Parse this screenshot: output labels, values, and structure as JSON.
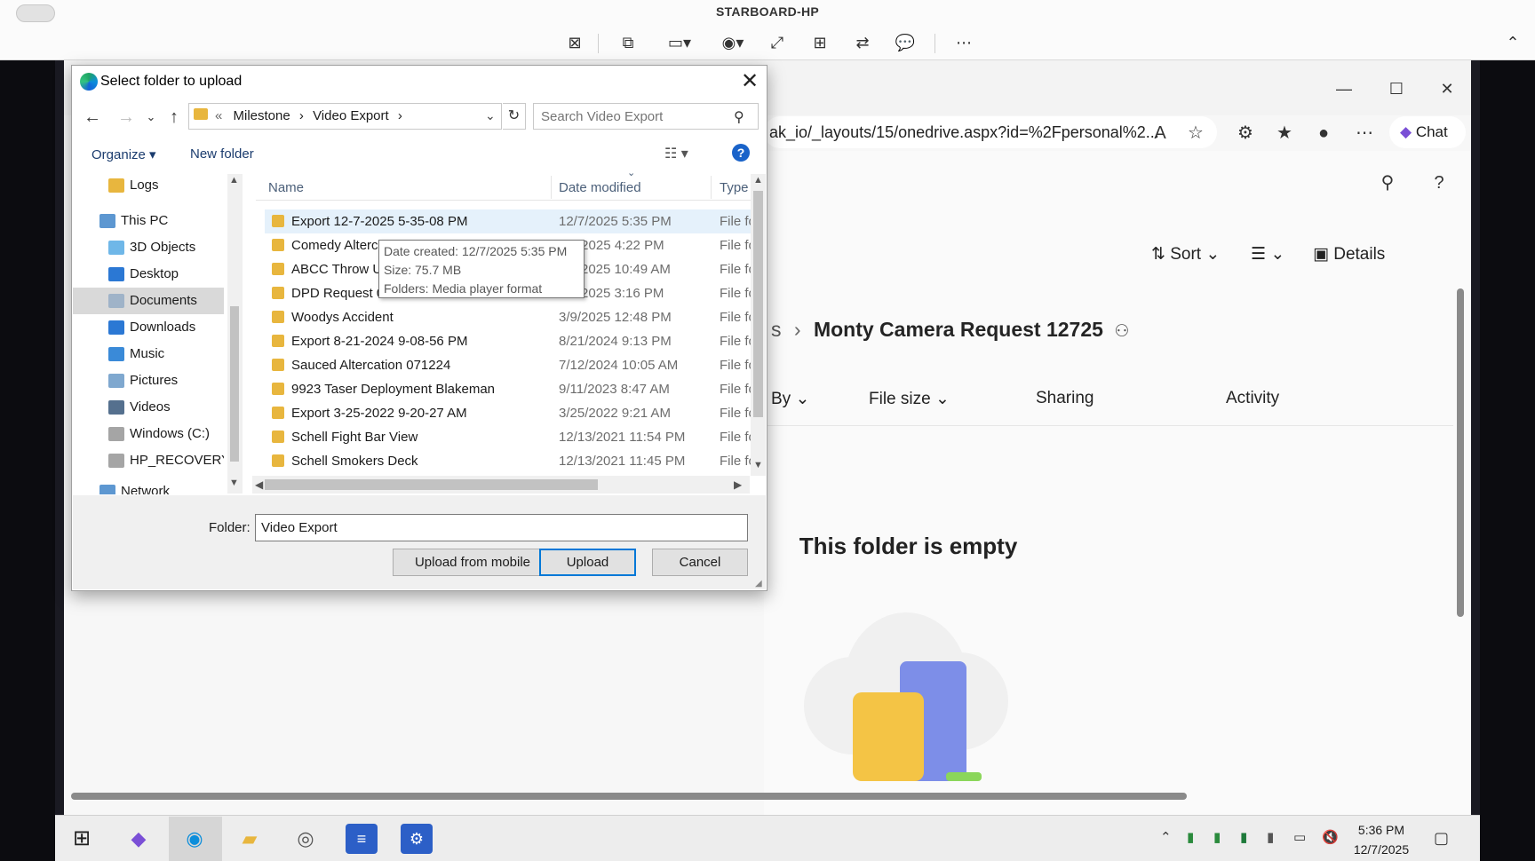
{
  "remote_session": {
    "title": "STARBOARD-HP",
    "toolbar_icons": [
      "disconnect-icon",
      "display-icon",
      "monitor-select-icon",
      "view-icon",
      "fullscreen-icon",
      "multi-monitor-icon",
      "switch-icon",
      "chat-icon",
      "more-icon",
      "collapse-icon"
    ]
  },
  "browser": {
    "address": "ak_io/_layouts/15/onedrive.aspx?id=%2Fpersonal%2...",
    "chat_label": "Chat",
    "window_controls": [
      "minimize-icon",
      "maximize-icon",
      "close-icon"
    ]
  },
  "onedrive": {
    "commands": {
      "sort": "Sort",
      "details": "Details"
    },
    "breadcrumb_prefix": "s",
    "breadcrumb_current": "Monty Camera Request 12725",
    "columns": {
      "by": "By",
      "file_size": "File size",
      "sharing": "Sharing",
      "activity": "Activity"
    },
    "empty_message": "This folder is empty"
  },
  "dialog": {
    "title": "Select folder to upload",
    "address_path": [
      "Milestone",
      "Video Export"
    ],
    "search_placeholder": "Search Video Export",
    "organize_label": "Organize",
    "new_folder_label": "New folder",
    "nav_items": [
      {
        "label": "Logs",
        "icon": "folder-icon"
      },
      {
        "label": "This PC",
        "icon": "pc-icon"
      },
      {
        "label": "3D Objects",
        "icon": "3d-objects-icon"
      },
      {
        "label": "Desktop",
        "icon": "desktop-icon"
      },
      {
        "label": "Documents",
        "icon": "documents-icon",
        "selected": true
      },
      {
        "label": "Downloads",
        "icon": "downloads-icon"
      },
      {
        "label": "Music",
        "icon": "music-icon"
      },
      {
        "label": "Pictures",
        "icon": "pictures-icon"
      },
      {
        "label": "Videos",
        "icon": "videos-icon"
      },
      {
        "label": "Windows (C:)",
        "icon": "drive-icon"
      },
      {
        "label": "HP_RECOVERY (I",
        "icon": "drive-icon"
      },
      {
        "label": "Network",
        "icon": "network-icon"
      }
    ],
    "columns": {
      "name": "Name",
      "date": "Date modified",
      "type": "Type"
    },
    "files": [
      {
        "name": "Export 12-7-2025 5-35-08 PM",
        "date": "12/7/2025 5:35 PM",
        "type": "File fo"
      },
      {
        "name": "Comedy Alterc",
        "date": "/2025 4:22 PM",
        "type": "File fo"
      },
      {
        "name": "ABCC Throw Up",
        "date": "2025 10:49 AM",
        "type": "File fo"
      },
      {
        "name": "DPD Request 0",
        "date": "2025 3:16 PM",
        "type": "File fo"
      },
      {
        "name": "Woodys Accident",
        "date": "3/9/2025 12:48 PM",
        "type": "File fo"
      },
      {
        "name": "Export 8-21-2024 9-08-56 PM",
        "date": "8/21/2024 9:13 PM",
        "type": "File fo"
      },
      {
        "name": "Sauced Altercation 071224",
        "date": "7/12/2024 10:05 AM",
        "type": "File fo"
      },
      {
        "name": "9923 Taser Deployment Blakeman",
        "date": "9/11/2023 8:47 AM",
        "type": "File fo"
      },
      {
        "name": "Export 3-25-2022 9-20-27 AM",
        "date": "3/25/2022 9:21 AM",
        "type": "File fo"
      },
      {
        "name": "Schell Fight Bar View",
        "date": "12/13/2021 11:54 PM",
        "type": "File fo"
      },
      {
        "name": "Schell Smokers Deck",
        "date": "12/13/2021 11:45 PM",
        "type": "File fo"
      }
    ],
    "tooltip": {
      "created": "Date created: 12/7/2025 5:35 PM",
      "size": "Size: 75.7 MB",
      "folders": "Folders: Media player format"
    },
    "folder_label": "Folder:",
    "folder_value": "Video Export",
    "buttons": {
      "upload_mobile": "Upload from mobile",
      "upload": "Upload",
      "cancel": "Cancel"
    }
  },
  "taskbar": {
    "apps": [
      "copilot-icon",
      "edge-icon",
      "file-explorer-icon",
      "chrome-like-icon",
      "app-icon",
      "settings-app-icon"
    ],
    "time": "5:36 PM",
    "date": "12/7/2025"
  }
}
